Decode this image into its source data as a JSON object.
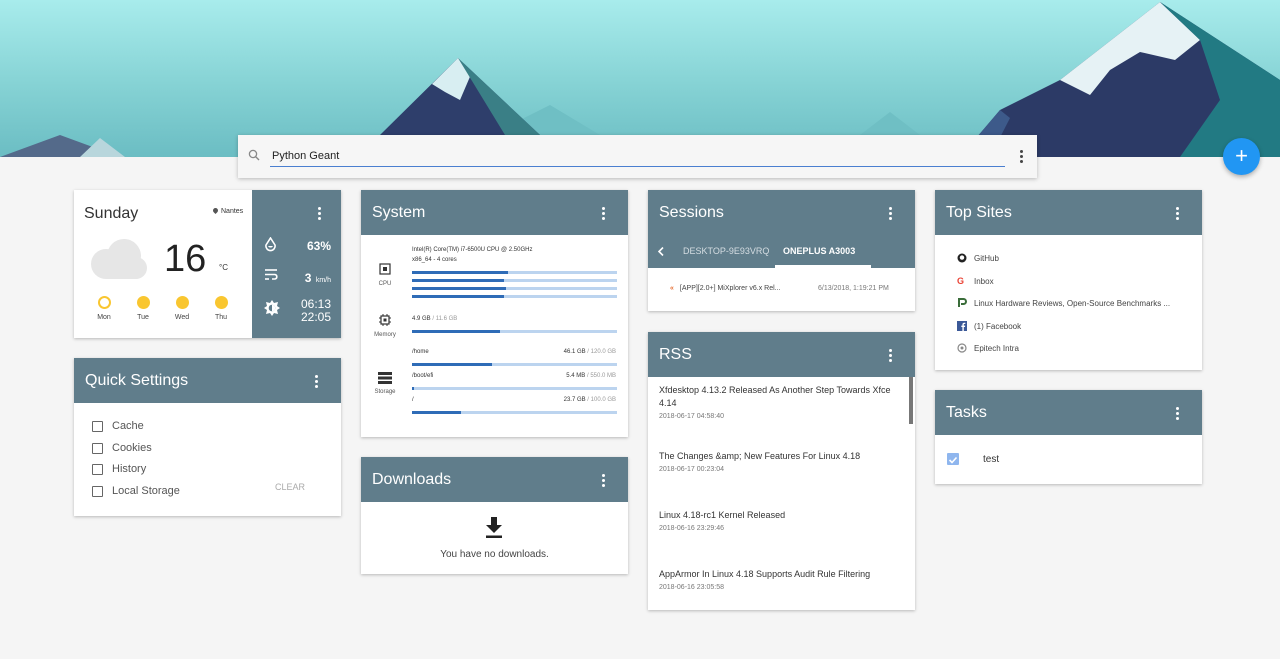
{
  "search": {
    "value": "Python Geant",
    "placeholder": ""
  },
  "fab": {
    "label": "+"
  },
  "weather": {
    "day": "Sunday",
    "location": "Nantes",
    "temperature": "16",
    "unit": "°C",
    "humidity": "63%",
    "wind_value": "3",
    "wind_unit": "km/h",
    "sunrise": "06:13",
    "sunset": "22:05",
    "forecast": [
      "Mon",
      "Tue",
      "Wed",
      "Thu"
    ]
  },
  "quick_settings": {
    "title": "Quick Settings",
    "items": [
      "Cache",
      "Cookies",
      "History",
      "Local Storage"
    ],
    "clear_label": "CLEAR"
  },
  "system": {
    "title": "System",
    "cpu_label": "CPU",
    "cpu_model": "Intel(R) Core(TM) i7-6500U CPU @ 2.50GHz",
    "cpu_arch": "x86_64 - 4 cores",
    "cpu_usage": [
      0.47,
      0.45,
      0.46,
      0.45
    ],
    "memory_label": "Memory",
    "memory_used": "4.9 GB",
    "memory_sep": " / ",
    "memory_total": "11.6 GB",
    "memory_usage": 0.43,
    "storage_label": "Storage",
    "disks": [
      {
        "path": "/home",
        "used": "46.1 GB",
        "sep": " / ",
        "total": "120.0 GB",
        "usage": 0.39
      },
      {
        "path": "/boot/efi",
        "used": "5.4 MB",
        "sep": " / ",
        "total": "550.0 MB",
        "usage": 0.01
      },
      {
        "path": "/",
        "used": "23.7 GB",
        "sep": " / ",
        "total": "100.0 GB",
        "usage": 0.24
      }
    ]
  },
  "downloads": {
    "title": "Downloads",
    "empty_text": "You have no downloads."
  },
  "sessions": {
    "title": "Sessions",
    "tabs": [
      "DESKTOP-9E93VRQ",
      "ONEPLUS A3003"
    ],
    "active_tab": "ONEPLUS A3003",
    "items": [
      {
        "title": "[APP][2.0+] MiXplorer v6.x Rel...",
        "date": "6/13/2018, 1:19:21 PM"
      }
    ]
  },
  "rss": {
    "title": "RSS",
    "items": [
      {
        "title": "Xfdesktop 4.13.2 Released As Another Step Towards Xfce 4.14",
        "date": "2018-06-17 04:58:40"
      },
      {
        "title": "The Changes &amp; New Features For Linux 4.18",
        "date": "2018-06-17 00:23:04"
      },
      {
        "title": "Linux 4.18-rc1 Kernel Released",
        "date": "2018-06-16 23:29:46"
      },
      {
        "title": "AppArmor In Linux 4.18 Supports Audit Rule Filtering",
        "date": "2018-06-16 23:05:58"
      }
    ]
  },
  "top_sites": {
    "title": "Top Sites",
    "items": [
      {
        "label": "GitHub",
        "icon": "github-icon"
      },
      {
        "label": "Inbox",
        "icon": "google-icon"
      },
      {
        "label": "Linux Hardware Reviews, Open-Source Benchmarks ...",
        "icon": "phoronix-icon"
      },
      {
        "label": "(1) Facebook",
        "icon": "facebook-icon"
      },
      {
        "label": "Epitech Intra",
        "icon": "epitech-icon"
      }
    ]
  },
  "tasks": {
    "title": "Tasks",
    "items": [
      {
        "label": "test",
        "done": true
      }
    ]
  },
  "colors": {
    "header": "#607d8b",
    "accent": "#2196f3",
    "bar_fill": "#2f6cb7",
    "bar_track": "#bcd4ef",
    "sun": "#f9c630"
  }
}
